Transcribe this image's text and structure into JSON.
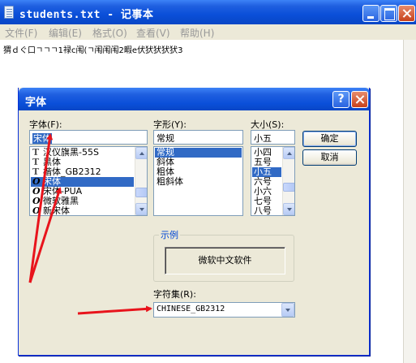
{
  "notepad": {
    "title": "students.txt - 记事本",
    "menu": [
      "文件(F)",
      "编辑(E)",
      "格式(O)",
      "查看(V)",
      "帮助(H)"
    ],
    "content": "猬ｄぐ口ㄱㄱㄱ1禄c闱(ㄱ闱闱闱2睱e伏犾犾犾犾3"
  },
  "dialog": {
    "title": "字体",
    "help_label": "?",
    "font_label": "字体(F):",
    "font_value": "宋体",
    "fonts": [
      {
        "name": "汉仪旗黑-55S",
        "icon": "truetype-icon",
        "glyph": "T"
      },
      {
        "name": "黑体",
        "icon": "truetype-icon",
        "glyph": "T"
      },
      {
        "name": "楷体_GB2312",
        "icon": "truetype-icon",
        "glyph": "T"
      },
      {
        "name": "宋体",
        "icon": "opentype-icon",
        "glyph": "O"
      },
      {
        "name": "宋体-PUA",
        "icon": "opentype-icon",
        "glyph": "O"
      },
      {
        "name": "微软雅黑",
        "icon": "opentype-icon",
        "glyph": "O"
      },
      {
        "name": "新宋体",
        "icon": "opentype-icon",
        "glyph": "O"
      }
    ],
    "selected_font_index": 3,
    "style_label": "字形(Y):",
    "style_value": "常规",
    "styles": [
      "常规",
      "斜体",
      "粗体",
      "粗斜体"
    ],
    "selected_style_index": 0,
    "size_label": "大小(S):",
    "size_value": "小五",
    "sizes": [
      "小四",
      "五号",
      "小五",
      "六号",
      "小六",
      "七号",
      "八号"
    ],
    "selected_size_index": 2,
    "ok_label": "确定",
    "cancel_label": "取消",
    "sample_group_label": "示例",
    "sample_text": "微软中文软件",
    "charset_label": "字符集(R):",
    "charset_value": "CHINESE_GB2312"
  },
  "annotation_color": "#e8141c"
}
